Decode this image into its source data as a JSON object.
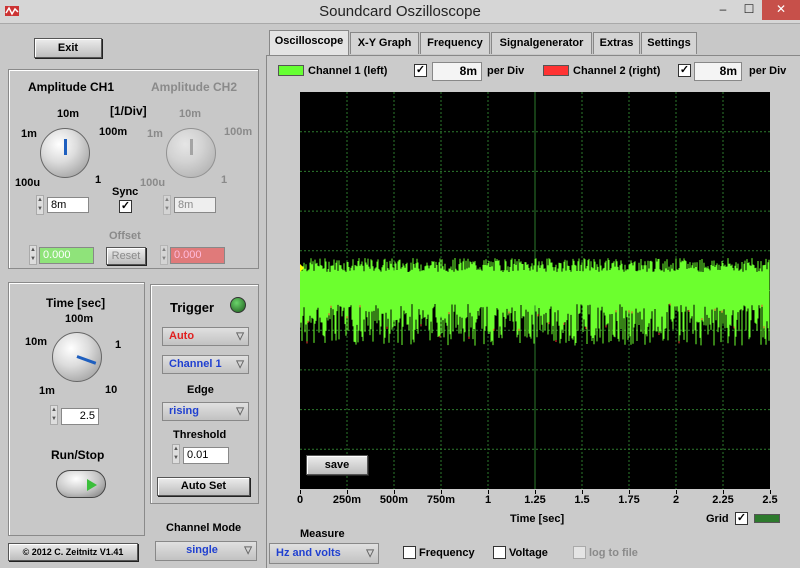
{
  "window": {
    "title": "Soundcard Oszilloscope",
    "min": "–",
    "max": "☐",
    "close": "✕"
  },
  "left": {
    "exit_label": "Exit",
    "amp_ch1_title": "Amplitude CH1",
    "amp_ch2_title": "Amplitude CH2",
    "unit_label": "[1/Div]",
    "ch1_knob": {
      "labels": [
        "100u",
        "1m",
        "10m",
        "100m",
        "1"
      ],
      "value": "8m"
    },
    "ch2_knob": {
      "labels": [
        "100u",
        "1m",
        "10m",
        "100m",
        "1"
      ],
      "value": "8m"
    },
    "sync_label": "Sync",
    "sync_checked": "✓",
    "offset_label": "Offset",
    "offset_ch1": "0.000",
    "offset_ch2": "0.000",
    "reset_label": "Reset",
    "time_title": "Time [sec]",
    "time_knob": {
      "labels": [
        "1m",
        "10m",
        "100m",
        "1",
        "10"
      ],
      "value": "2.5"
    },
    "runstop_label": "Run/Stop",
    "copyright": "© 2012  C. Zeitnitz V1.41"
  },
  "trigger": {
    "title": "Trigger",
    "mode": "Auto",
    "channel": "Channel 1",
    "edge_label": "Edge",
    "edge": "rising",
    "threshold_label": "Threshold",
    "threshold": "0.01",
    "autoset_label": "Auto Set"
  },
  "channel_mode": {
    "label": "Channel Mode",
    "value": "single"
  },
  "tabs": [
    {
      "label": "Oscilloscope",
      "active": true
    },
    {
      "label": "X-Y Graph"
    },
    {
      "label": "Frequency"
    },
    {
      "label": "Signalgenerator"
    },
    {
      "label": "Extras"
    },
    {
      "label": "Settings"
    }
  ],
  "channels": {
    "ch1_label": "Channel 1 (left)",
    "ch1_color": "#66ff33",
    "ch1_checked": "✓",
    "ch1_value": "8m",
    "ch2_label": "Channel 2 (right)",
    "ch2_color": "#ff3333",
    "ch2_checked": "✓",
    "ch2_value": "8m",
    "per_div": "per Div"
  },
  "scope": {
    "background": "#000000",
    "grid_color": "#2d7a2d",
    "save_label": "save",
    "xticks": [
      "0",
      "250m",
      "500m",
      "750m",
      "1",
      "1.25",
      "1.5",
      "1.75",
      "2",
      "2.25",
      "2.5"
    ],
    "xlabel": "Time [sec]",
    "grid_label": "Grid",
    "grid_checked": "✓"
  },
  "measure": {
    "label": "Measure",
    "value": "Hz and volts",
    "frequency_label": "Frequency",
    "voltage_label": "Voltage",
    "logfile_label": "log to file"
  }
}
